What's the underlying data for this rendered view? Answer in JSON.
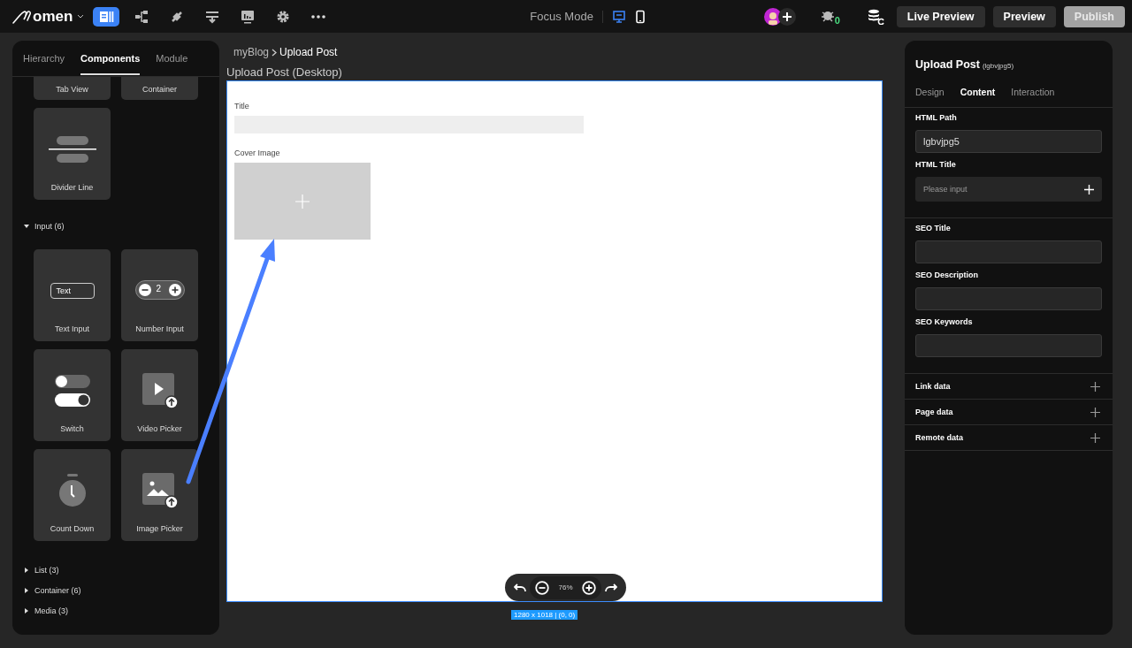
{
  "top_bar": {
    "logo": "omen",
    "tools": [
      {
        "kind": "pages",
        "selected": true
      },
      {
        "kind": "flow",
        "selected": false
      },
      {
        "kind": "plug",
        "selected": false
      },
      {
        "kind": "merge",
        "selected": false
      },
      {
        "kind": "board",
        "selected": false
      },
      {
        "kind": "gear",
        "selected": false
      },
      {
        "kind": "more",
        "selected": false
      }
    ],
    "focus_mode": "Focus Mode",
    "devices": [
      {
        "kind": "desktop",
        "selected": true
      },
      {
        "kind": "mobile",
        "selected": false
      }
    ],
    "bug_count": "0",
    "buttons": [
      {
        "label": "Live Preview",
        "disabled": false
      },
      {
        "label": "Preview",
        "disabled": false
      },
      {
        "label": "Publish",
        "disabled": true
      }
    ]
  },
  "left_panel": {
    "tabs": [
      {
        "label": "Hierarchy",
        "selected": false
      },
      {
        "label": "Components",
        "selected": true
      },
      {
        "label": "Module",
        "selected": false
      }
    ],
    "cut_cards": [
      "Tab View",
      "Container"
    ],
    "cards": [
      {
        "label": "Divider Line",
        "kind": "divider"
      }
    ],
    "groups": [
      {
        "label": "Input (6)",
        "expanded": true,
        "cards": [
          {
            "label": "Text Input",
            "kind": "text",
            "sample": "Text"
          },
          {
            "label": "Number Input",
            "kind": "number",
            "sample": "2"
          },
          {
            "label": "Switch",
            "kind": "switch"
          },
          {
            "label": "Video Picker",
            "kind": "video"
          },
          {
            "label": "Count Down",
            "kind": "timer"
          },
          {
            "label": "Image Picker",
            "kind": "image"
          }
        ]
      },
      {
        "label": "List (3)",
        "expanded": false
      },
      {
        "label": "Container (6)",
        "expanded": false
      },
      {
        "label": "Media (3)",
        "expanded": false
      }
    ]
  },
  "canvas": {
    "breadcrumb": [
      "myBlog",
      "Upload Post"
    ],
    "frame_title": "Upload Post (Desktop)",
    "fields": [
      {
        "label": "Title",
        "kind": "input"
      },
      {
        "label": "Cover Image",
        "kind": "image"
      }
    ],
    "zoom": "76%",
    "size_label": "1280 x 1018 | (0, 0)"
  },
  "right_panel": {
    "title": "Upload Post",
    "id": "(lgbvjpg5)",
    "tabs": [
      {
        "label": "Design",
        "selected": false
      },
      {
        "label": "Content",
        "selected": true
      },
      {
        "label": "Interaction",
        "selected": false
      }
    ],
    "sections": [
      [
        {
          "label": "HTML Path",
          "value": "lgbvjpg5"
        },
        {
          "label": "HTML Title",
          "placeholder": "Please input",
          "addable": true
        }
      ],
      [
        {
          "label": "SEO Title"
        },
        {
          "label": "SEO Description"
        },
        {
          "label": "SEO Keywords"
        }
      ]
    ],
    "data_rows": [
      "Link data",
      "Page data",
      "Remote data"
    ]
  }
}
